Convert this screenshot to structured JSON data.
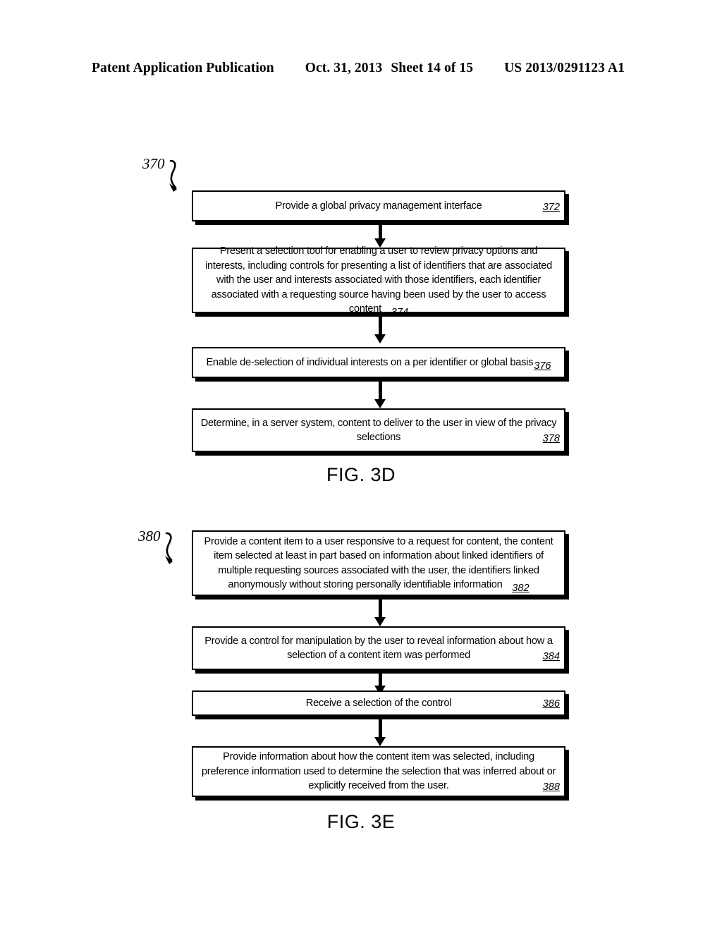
{
  "header": {
    "publication": "Patent Application Publication",
    "date": "Oct. 31, 2013",
    "sheet": "Sheet 14 of 15",
    "patent_number": "US 2013/0291123 A1"
  },
  "figures": [
    {
      "caption": "FIG. 3D",
      "callout": "370",
      "steps": [
        {
          "ref": "372",
          "ref_style": "corner",
          "text": "Provide a global privacy management interface"
        },
        {
          "ref": "374",
          "ref_style": "corner",
          "text": "Present a selection tool for enabling a user to review privacy options and interests, including controls for presenting a list of identifiers that are associated with the user and interests associated with those identifiers, each identifier associated with a requesting source having been used by the user to access content"
        },
        {
          "ref": "376",
          "ref_style": "inline",
          "text": "Enable de-selection of individual interests on a per identifier or global basis"
        },
        {
          "ref": "378",
          "ref_style": "corner",
          "text": "Determine, in a server system, content to deliver to the user in view of the privacy selections"
        }
      ]
    },
    {
      "caption": "FIG. 3E",
      "callout": "380",
      "steps": [
        {
          "ref": "382",
          "ref_style": "corner",
          "text": "Provide a content item to a user responsive to a request for content, the content item selected at least in part based on information about linked identifiers of multiple requesting sources associated with the user, the identifiers linked anonymously without storing personally identifiable information"
        },
        {
          "ref": "384",
          "ref_style": "corner",
          "text": "Provide a control for manipulation by the user to reveal information about how a selection of a content item was performed"
        },
        {
          "ref": "386",
          "ref_style": "corner",
          "text": "Receive a selection of the control"
        },
        {
          "ref": "388",
          "ref_style": "corner",
          "text": "Provide information about how the content item was selected, including preference information used to determine the selection that was inferred about or explicitly received from the user."
        }
      ]
    }
  ],
  "colors": {
    "ink": "#000000",
    "page": "#ffffff"
  }
}
